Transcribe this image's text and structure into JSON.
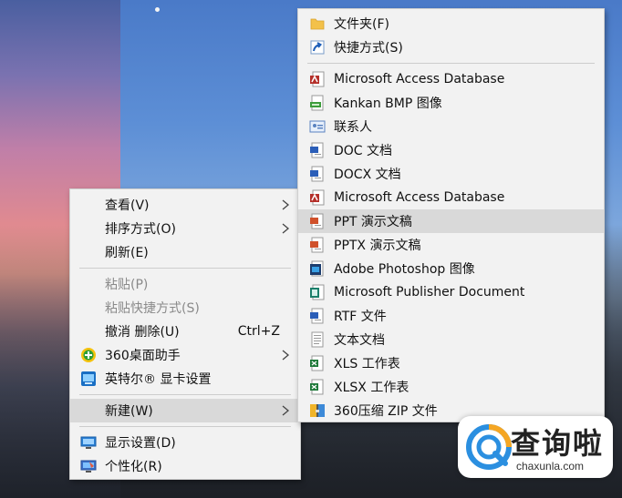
{
  "context_menu": {
    "view": "查看(V)",
    "sort": "排序方式(O)",
    "refresh": "刷新(E)",
    "paste": "粘贴(P)",
    "paste_shortcut": "粘贴快捷方式(S)",
    "undo": "撤消 删除(U)",
    "undo_shortcut": "Ctrl+Z",
    "desktop_helper": "360桌面助手",
    "intel_graphics": "英特尔® 显卡设置",
    "new": "新建(W)",
    "display_settings": "显示设置(D)",
    "personalize": "个性化(R)"
  },
  "new_submenu": {
    "folder": "文件夹(F)",
    "shortcut": "快捷方式(S)",
    "access_db_1": "Microsoft Access Database",
    "kankan_bmp": "Kankan BMP 图像",
    "contact": "联系人",
    "doc": "DOC 文档",
    "docx": "DOCX 文档",
    "access_db_2": "Microsoft Access Database",
    "ppt": "PPT 演示文稿",
    "pptx": "PPTX 演示文稿",
    "psd": "Adobe Photoshop 图像",
    "publisher": "Microsoft Publisher Document",
    "rtf": "RTF 文件",
    "txt": "文本文档",
    "xls": "XLS 工作表",
    "xlsx": "XLSX 工作表",
    "zip": "360压缩 ZIP 文件"
  },
  "watermark": {
    "title": "查询啦",
    "url": "chaxunla.com"
  },
  "colors": {
    "menu_bg": "#f2f2f2",
    "highlight": "#d9d9d9",
    "disabled_text": "#8a8a8a",
    "separator": "#cdcdcd"
  }
}
